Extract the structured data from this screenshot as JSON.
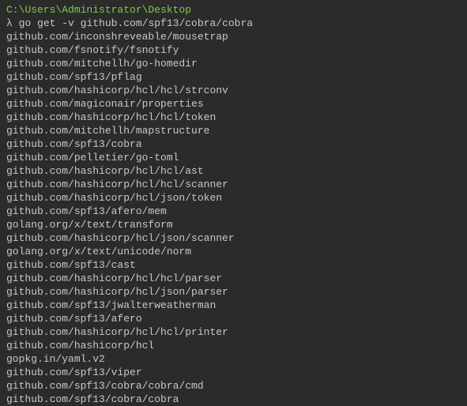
{
  "terminal": {
    "cwd": "C:\\Users\\Administrator\\Desktop",
    "prompt_symbol": "λ",
    "command": "go get -v github.com/spf13/cobra/cobra",
    "output": [
      "github.com/inconshreveable/mousetrap",
      "github.com/fsnotify/fsnotify",
      "github.com/mitchellh/go-homedir",
      "github.com/spf13/pflag",
      "github.com/hashicorp/hcl/hcl/strconv",
      "github.com/magiconair/properties",
      "github.com/hashicorp/hcl/hcl/token",
      "github.com/mitchellh/mapstructure",
      "github.com/spf13/cobra",
      "github.com/pelletier/go-toml",
      "github.com/hashicorp/hcl/hcl/ast",
      "github.com/hashicorp/hcl/hcl/scanner",
      "github.com/hashicorp/hcl/json/token",
      "github.com/spf13/afero/mem",
      "golang.org/x/text/transform",
      "github.com/hashicorp/hcl/json/scanner",
      "golang.org/x/text/unicode/norm",
      "github.com/spf13/cast",
      "github.com/hashicorp/hcl/hcl/parser",
      "github.com/hashicorp/hcl/json/parser",
      "github.com/spf13/jwalterweatherman",
      "github.com/spf13/afero",
      "github.com/hashicorp/hcl/hcl/printer",
      "github.com/hashicorp/hcl",
      "gopkg.in/yaml.v2",
      "github.com/spf13/viper",
      "github.com/spf13/cobra/cobra/cmd",
      "github.com/spf13/cobra/cobra"
    ]
  }
}
